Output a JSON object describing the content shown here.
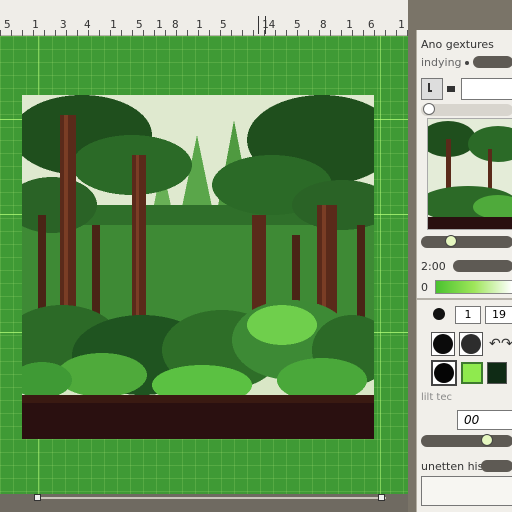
{
  "ruler": {
    "labels": [
      "5",
      "1",
      "3",
      "4",
      "1",
      "5",
      "1",
      "8",
      "1",
      "5",
      "14",
      "5",
      "8",
      "1",
      "6",
      "1"
    ]
  },
  "panel": {
    "title": "Ano gextures",
    "row1_label": "indying",
    "time_label": "2:00",
    "slider_label": "0",
    "num1": "1",
    "num2": "19",
    "undo_icon_text": "↶",
    "redo_icon_text": "↷",
    "section_label": "lilt tec",
    "value_field": "00",
    "footer_label": "unetten his",
    "colors": {
      "swatch_black": "#0b0b0b",
      "swatch_dark": "#2d2d2d",
      "swatch_black2": "#050505",
      "swatch_lime": "#8fea4e",
      "swatch_darkgreen": "#0f2b15",
      "swatch_forest": "#113a1e",
      "slider_green": "#62d23a"
    }
  },
  "canvas": {
    "bg_color": "#3f9a35",
    "guide_color": "#b6ff7a"
  }
}
